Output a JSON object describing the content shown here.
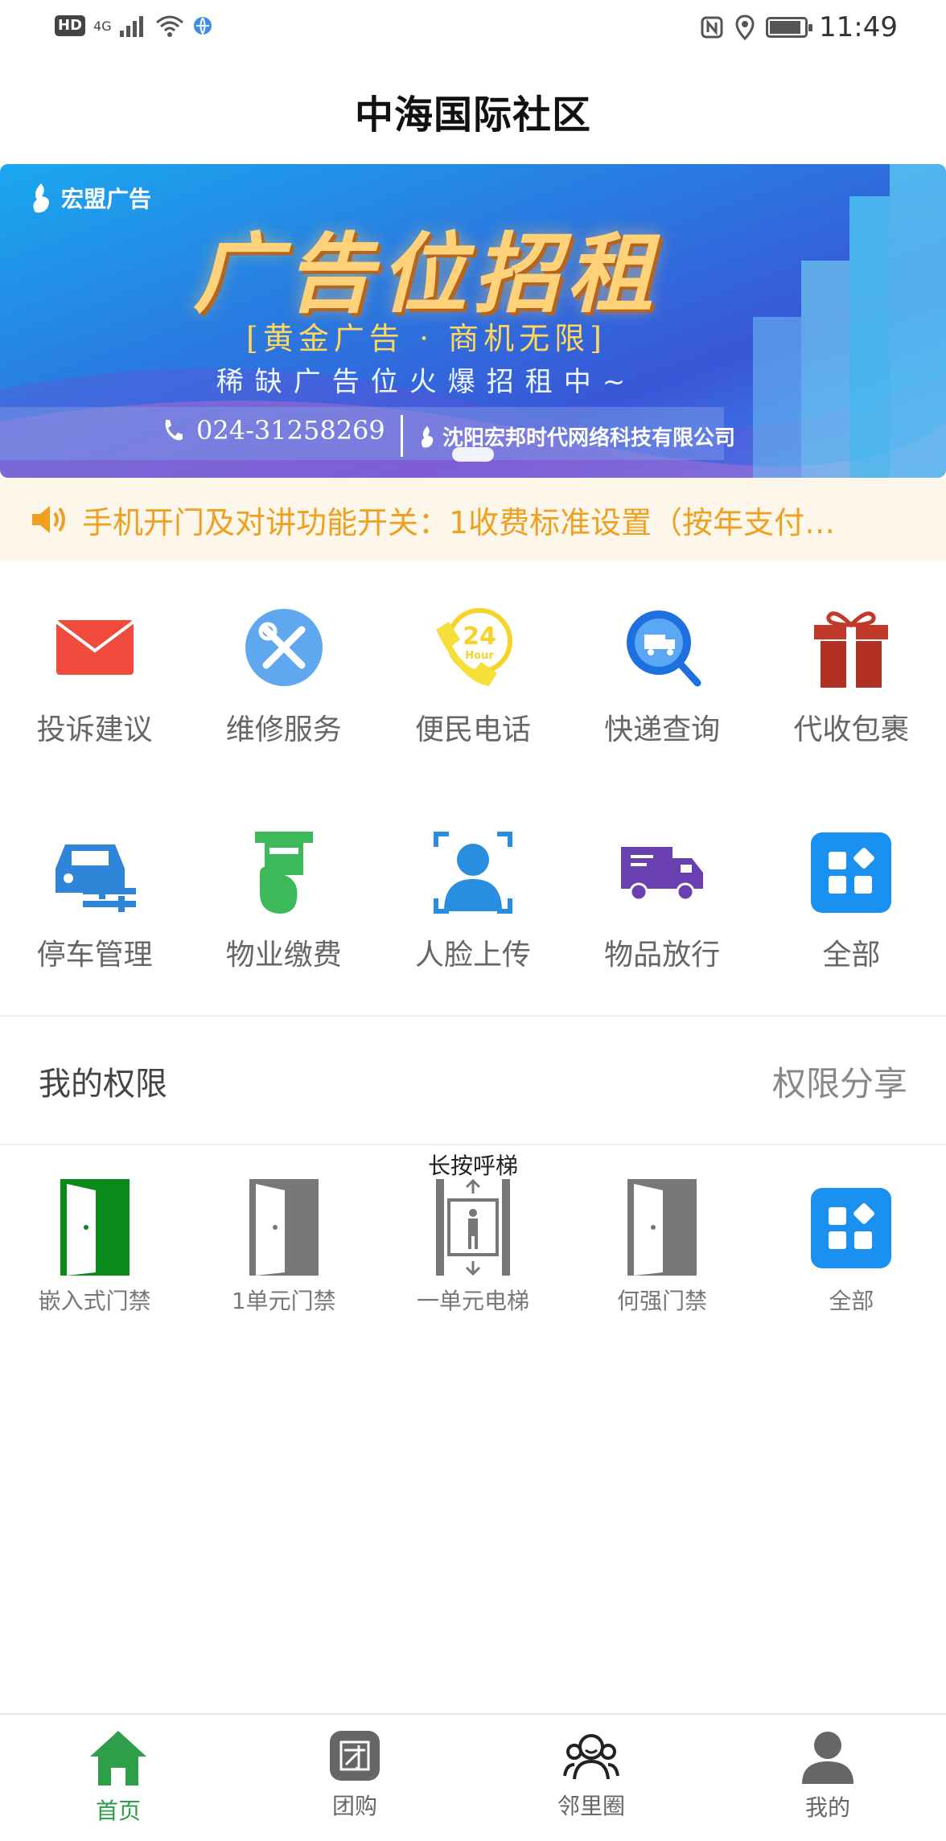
{
  "status_bar": {
    "left_badge": "HD",
    "network": "4G",
    "time": "11:49"
  },
  "header": {
    "title": "中海国际社区"
  },
  "banner": {
    "brand": "宏盟广告",
    "headline": "广告位招租",
    "subline": "[黄金广告 · 商机无限]",
    "subline2": "稀缺广告位火爆招租中~",
    "phone": "024-31258269",
    "company": "沈阳宏邦时代网络科技有限公司"
  },
  "notice": {
    "text": "手机开门及对讲功能开关：1收费标准设置（按年支付…"
  },
  "services_row1": [
    {
      "label": "投诉建议",
      "icon": "mail-icon",
      "color": "#f04b3c"
    },
    {
      "label": "维修服务",
      "icon": "tools-icon",
      "color": "#5fa8f0"
    },
    {
      "label": "便民电话",
      "icon": "24h-phone-icon",
      "color": "#f5d327"
    },
    {
      "label": "快递查询",
      "icon": "delivery-search-icon",
      "color": "#1e6fe0"
    },
    {
      "label": "代收包裹",
      "icon": "gift-icon",
      "color": "#c0392b"
    }
  ],
  "services_row2": [
    {
      "label": "停车管理",
      "icon": "car-icon",
      "color": "#2f86d8"
    },
    {
      "label": "物业缴费",
      "icon": "payment-icon",
      "color": "#3cba5a"
    },
    {
      "label": "人脸上传",
      "icon": "face-scan-icon",
      "color": "#2a8ee0"
    },
    {
      "label": "物品放行",
      "icon": "truck-icon",
      "color": "#6a3fb0"
    },
    {
      "label": "全部",
      "icon": "all-apps-icon",
      "color": "#1a90f0"
    }
  ],
  "permissions": {
    "title": "我的权限",
    "share": "权限分享",
    "hint": "长按呼梯",
    "items": [
      {
        "label": "嵌入式门禁",
        "icon": "door-icon",
        "color": "#0a8a1a"
      },
      {
        "label": "1单元门禁",
        "icon": "door-icon",
        "color": "#777777"
      },
      {
        "label": "一单元电梯",
        "icon": "elevator-icon",
        "color": "#777777"
      },
      {
        "label": "何强门禁",
        "icon": "door-icon",
        "color": "#777777"
      },
      {
        "label": "全部",
        "icon": "all-apps-icon",
        "color": "#1a90f0"
      }
    ]
  },
  "tabbar": {
    "items": [
      {
        "label": "首页",
        "icon": "home-icon",
        "active": true
      },
      {
        "label": "团购",
        "icon": "group-buy-icon",
        "active": false
      },
      {
        "label": "邻里圈",
        "icon": "neighbors-icon",
        "active": false
      },
      {
        "label": "我的",
        "icon": "profile-icon",
        "active": false
      }
    ],
    "active_color": "#2e9e4a"
  }
}
